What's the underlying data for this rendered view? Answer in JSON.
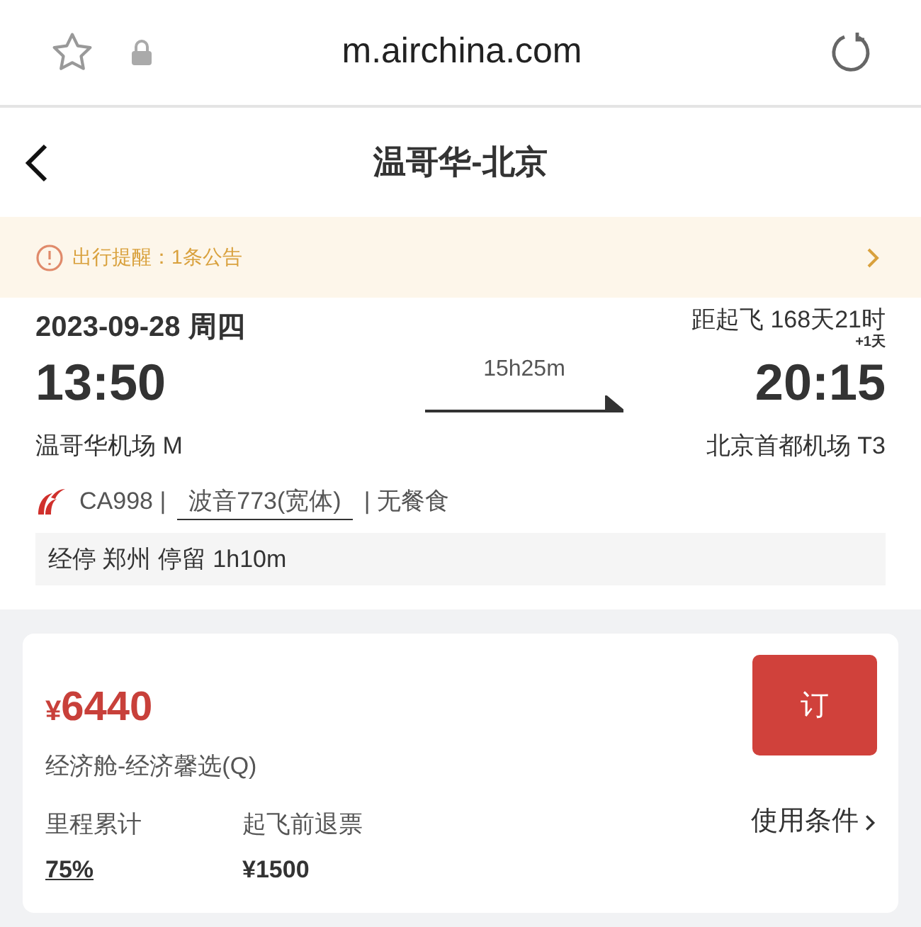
{
  "browser": {
    "url": "m.airchina.com"
  },
  "header": {
    "title": "温哥华-北京"
  },
  "notice": {
    "text": "出行提醒：1条公告"
  },
  "flight": {
    "date": "2023-09-28 周四",
    "countdown": "距起飞 168天21时",
    "depart_time": "13:50",
    "duration": "15h25m",
    "arrive_time": "20:15",
    "day_offset": "+1天",
    "depart_airport": "温哥华机场 M",
    "arrive_airport": "北京首都机场 T3",
    "flight_no": "CA998 |",
    "aircraft": "波音773(宽体)",
    "meal": "| 无餐食",
    "stopover": "经停 郑州 停留 1h10m"
  },
  "fare": {
    "currency": "¥",
    "price": "6440",
    "cabin": "经济舱-经济馨选(Q)",
    "book_button": "订",
    "miles_label": "里程累计",
    "miles_value": "75%",
    "refund_label": "起飞前退票",
    "refund_value": "¥1500",
    "conditions": "使用条件"
  }
}
